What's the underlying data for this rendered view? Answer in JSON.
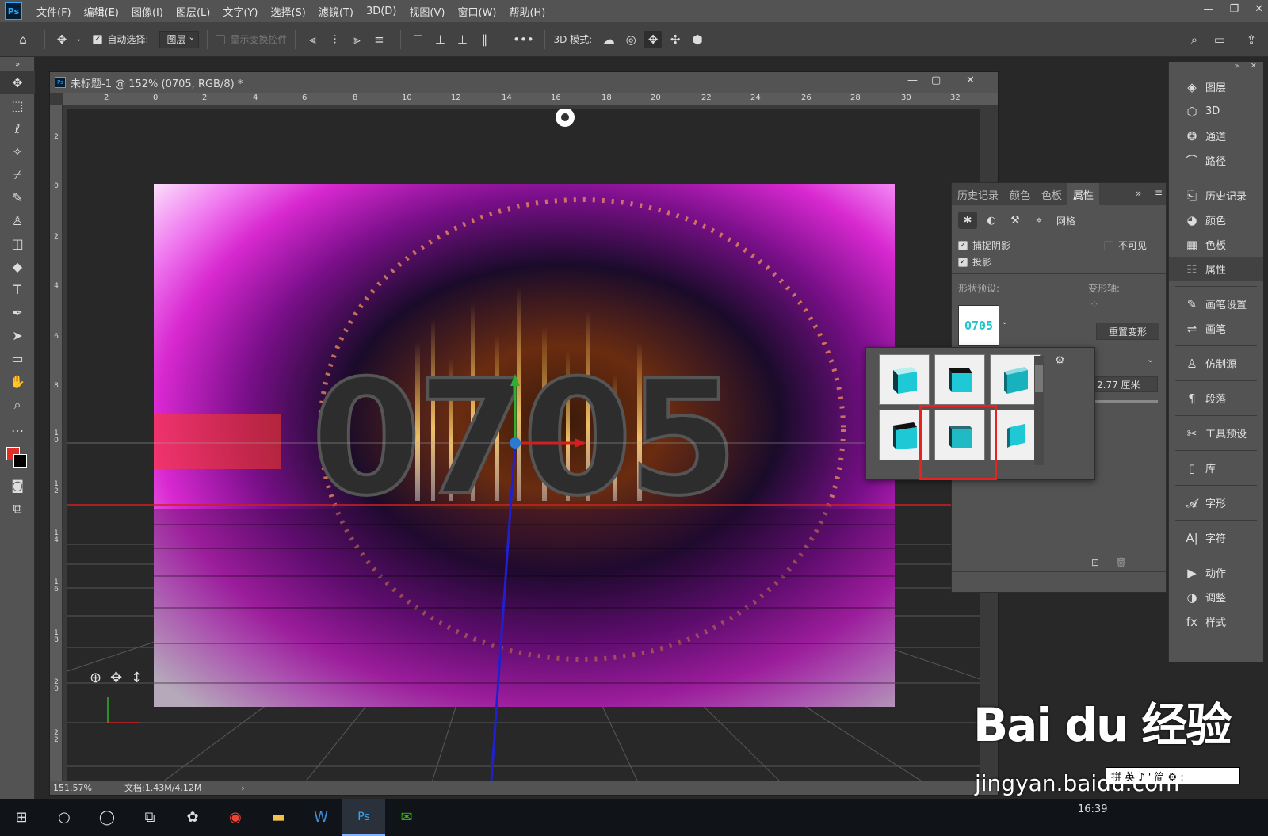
{
  "menubar": {
    "logo": "Ps",
    "items": [
      "文件(F)",
      "编辑(E)",
      "图像(I)",
      "图层(L)",
      "文字(Y)",
      "选择(S)",
      "滤镜(T)",
      "3D(D)",
      "视图(V)",
      "窗口(W)",
      "帮助(H)"
    ]
  },
  "optbar": {
    "auto_select_label": "自动选择:",
    "layer_dd": "图层",
    "show_transform": "显示变换控件",
    "mode_3d": "3D 模式:"
  },
  "document": {
    "title": "未标题-1 @ 152% (0705, RGB/8) *",
    "ruler_top": [
      "2",
      "0",
      "2",
      "4",
      "6",
      "8",
      "10",
      "12",
      "14",
      "16",
      "18",
      "20",
      "22",
      "24",
      "26",
      "28",
      "30",
      "32"
    ],
    "ruler_left": [
      "2",
      "0",
      "2",
      "4",
      "6",
      "8",
      "1\n0",
      "1\n2",
      "1\n4",
      "1\n6",
      "1\n8",
      "2\n0",
      "2\n2"
    ],
    "text_3d": "0705",
    "zoom": "151.57%",
    "doc_info": "文档:1.43M/4.12M"
  },
  "properties": {
    "tabs": [
      "历史记录",
      "颜色",
      "色板",
      "属性"
    ],
    "mesh_label": "网格",
    "catch_shadow": "捕捉阴影",
    "invisible": "不可见",
    "cast_shadow": "投影",
    "shape_preset_label": "形状预设:",
    "deform_axis_label": "变形轴:",
    "shape_thumb": "0705",
    "reset_deform": "重置变形",
    "depth_value": "2.77 厘米"
  },
  "dock": {
    "group1": [
      "图层",
      "3D",
      "通道",
      "路径"
    ],
    "group2": [
      "历史记录",
      "颜色",
      "色板",
      "属性"
    ],
    "group3": [
      "画笔设置",
      "画笔"
    ],
    "group4": [
      "仿制源"
    ],
    "group5": [
      "段落"
    ],
    "group6": [
      "工具预设"
    ],
    "group7": [
      "库"
    ],
    "group8": [
      "字形"
    ],
    "group9": [
      "字符"
    ],
    "group10": [
      "动作",
      "调整",
      "样式"
    ]
  },
  "taskbar": {
    "time": "16:39"
  },
  "watermark": {
    "brand": "Bai du 经验",
    "url": "jingyan.baidu.com",
    "ime": "拼 英 ♪ ' 简 ⚙ :"
  },
  "colors": {
    "accent_cyan": "#20c5cd",
    "highlight_red": "#e52421",
    "fg_color": "#e0302a"
  }
}
